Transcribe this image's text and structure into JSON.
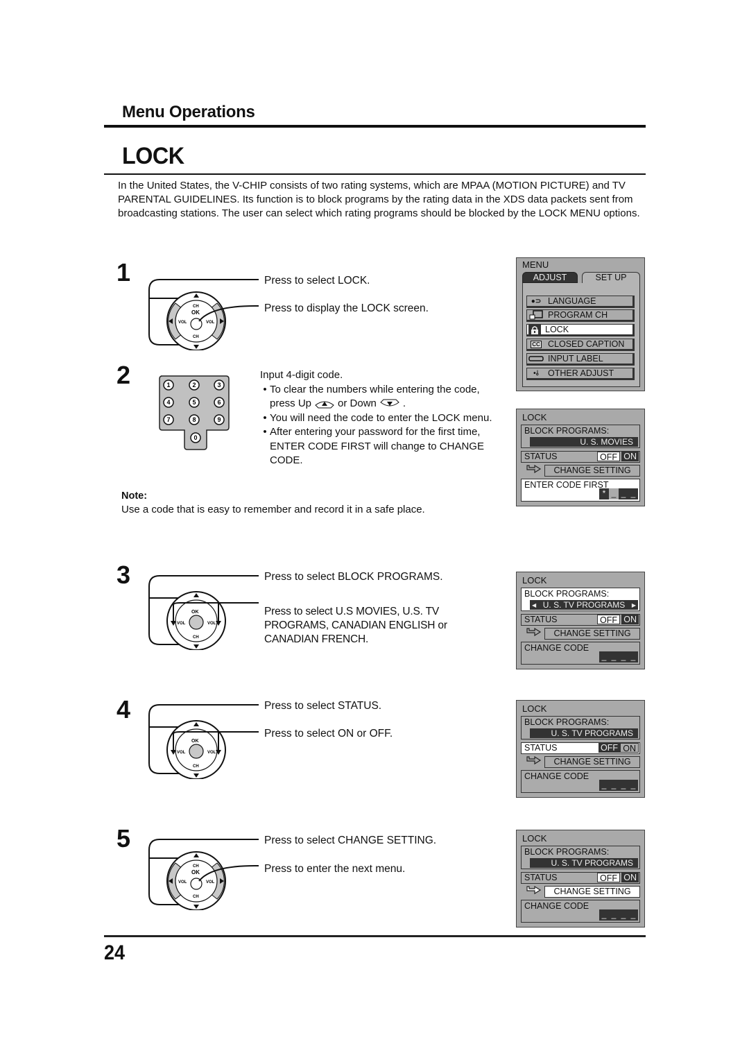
{
  "header": {
    "section_title": "Menu Operations",
    "page_title": "LOCK",
    "intro": "In the United States, the V-CHIP consists of two rating systems, which are MPAA (MOTION PICTURE) and TV PARENTAL GUIDELINES. Its function is to block programs by the rating data in the XDS data packets sent from broadcasting stations. The user can select which rating programs should be blocked by the LOCK MENU options."
  },
  "steps": [
    {
      "number": "1",
      "lines": [
        "Press to select LOCK.",
        "Press to display the LOCK screen."
      ]
    },
    {
      "number": "2",
      "lines": [
        "Input 4-digit code."
      ],
      "bullets": [
        {
          "pre": "To clear the numbers while entering the code,",
          "line2a": "press Up",
          "line2b": "or Down",
          "line2c": "."
        },
        {
          "text": "You will need the code to enter the LOCK menu."
        },
        {
          "text": "After entering your password for the first time, ENTER CODE FIRST will change to CHANGE CODE."
        }
      ],
      "keypad": [
        "1",
        "2",
        "3",
        "4",
        "5",
        "6",
        "7",
        "8",
        "9",
        "0"
      ]
    },
    {
      "number": "3",
      "lines": [
        "Press to select BLOCK PROGRAMS.",
        "Press to select U.S MOVIES, U.S. TV PROGRAMS, CANADIAN ENGLISH or CANADIAN FRENCH."
      ]
    },
    {
      "number": "4",
      "lines": [
        "Press to select STATUS.",
        "Press to select ON or OFF."
      ]
    },
    {
      "number": "5",
      "lines": [
        "Press to select CHANGE SETTING.",
        "Press to enter the next menu."
      ]
    }
  ],
  "note": {
    "heading": "Note:",
    "text": "Use a code that is easy to remember and record it in a safe place."
  },
  "remote_labels": {
    "ch": "CH",
    "ok": "OK",
    "vol": "VOL",
    "bullet": "•"
  },
  "menu_screen": {
    "title": "MENU",
    "tabs": [
      "ADJUST",
      "SET UP"
    ],
    "items": [
      {
        "icon": "language-icon",
        "label": "LANGUAGE"
      },
      {
        "icon": "program-ch-icon",
        "label": "PROGRAM  CH"
      },
      {
        "icon": "lock-icon",
        "label": "LOCK",
        "selected": true
      },
      {
        "icon": "closed-caption-icon",
        "label": "CLOSED  CAPTION"
      },
      {
        "icon": "input-label-icon",
        "label": "INPUT  LABEL"
      },
      {
        "icon": "other-adjust-icon",
        "label": "OTHER  ADJUST"
      }
    ]
  },
  "lock_screens": [
    {
      "title": "LOCK",
      "block_label": "BLOCK  PROGRAMS:",
      "block_value": "U. S.   MOVIES",
      "status_label": "STATUS",
      "off": "OFF",
      "on": "ON",
      "change_setting": "CHANGE  SETTING",
      "code_label": "ENTER  CODE  FIRST",
      "code": [
        "*",
        "_",
        "_",
        "_"
      ],
      "selected": "code"
    },
    {
      "title": "LOCK",
      "block_label": "BLOCK  PROGRAMS:",
      "block_value": "U. S.  TV PROGRAMS",
      "status_label": "STATUS",
      "off": "OFF",
      "on": "ON",
      "change_setting": "CHANGE  SETTING",
      "code_label": "CHANGE CODE",
      "code": [
        "_",
        "_",
        "_",
        "_"
      ],
      "selected": "block"
    },
    {
      "title": "LOCK",
      "block_label": "BLOCK  PROGRAMS:",
      "block_value": "U. S.  TV PROGRAMS",
      "status_label": "STATUS",
      "off": "OFF",
      "on": "ON",
      "change_setting": "CHANGE  SETTING",
      "code_label": "CHANGE CODE",
      "code": [
        "_",
        "_",
        "_",
        "_"
      ],
      "selected": "status"
    },
    {
      "title": "LOCK",
      "block_label": "BLOCK  PROGRAMS:",
      "block_value": "U. S.  TV PROGRAMS",
      "status_label": "STATUS",
      "off": "OFF",
      "on": "ON",
      "change_setting": "CHANGE  SETTING",
      "code_label": "CHANGE CODE",
      "code": [
        "_",
        "_",
        "_",
        "_"
      ],
      "selected": "change"
    }
  ],
  "arrows": {
    "left": "◀",
    "right": "▶"
  },
  "footer": {
    "page_number": "24"
  }
}
